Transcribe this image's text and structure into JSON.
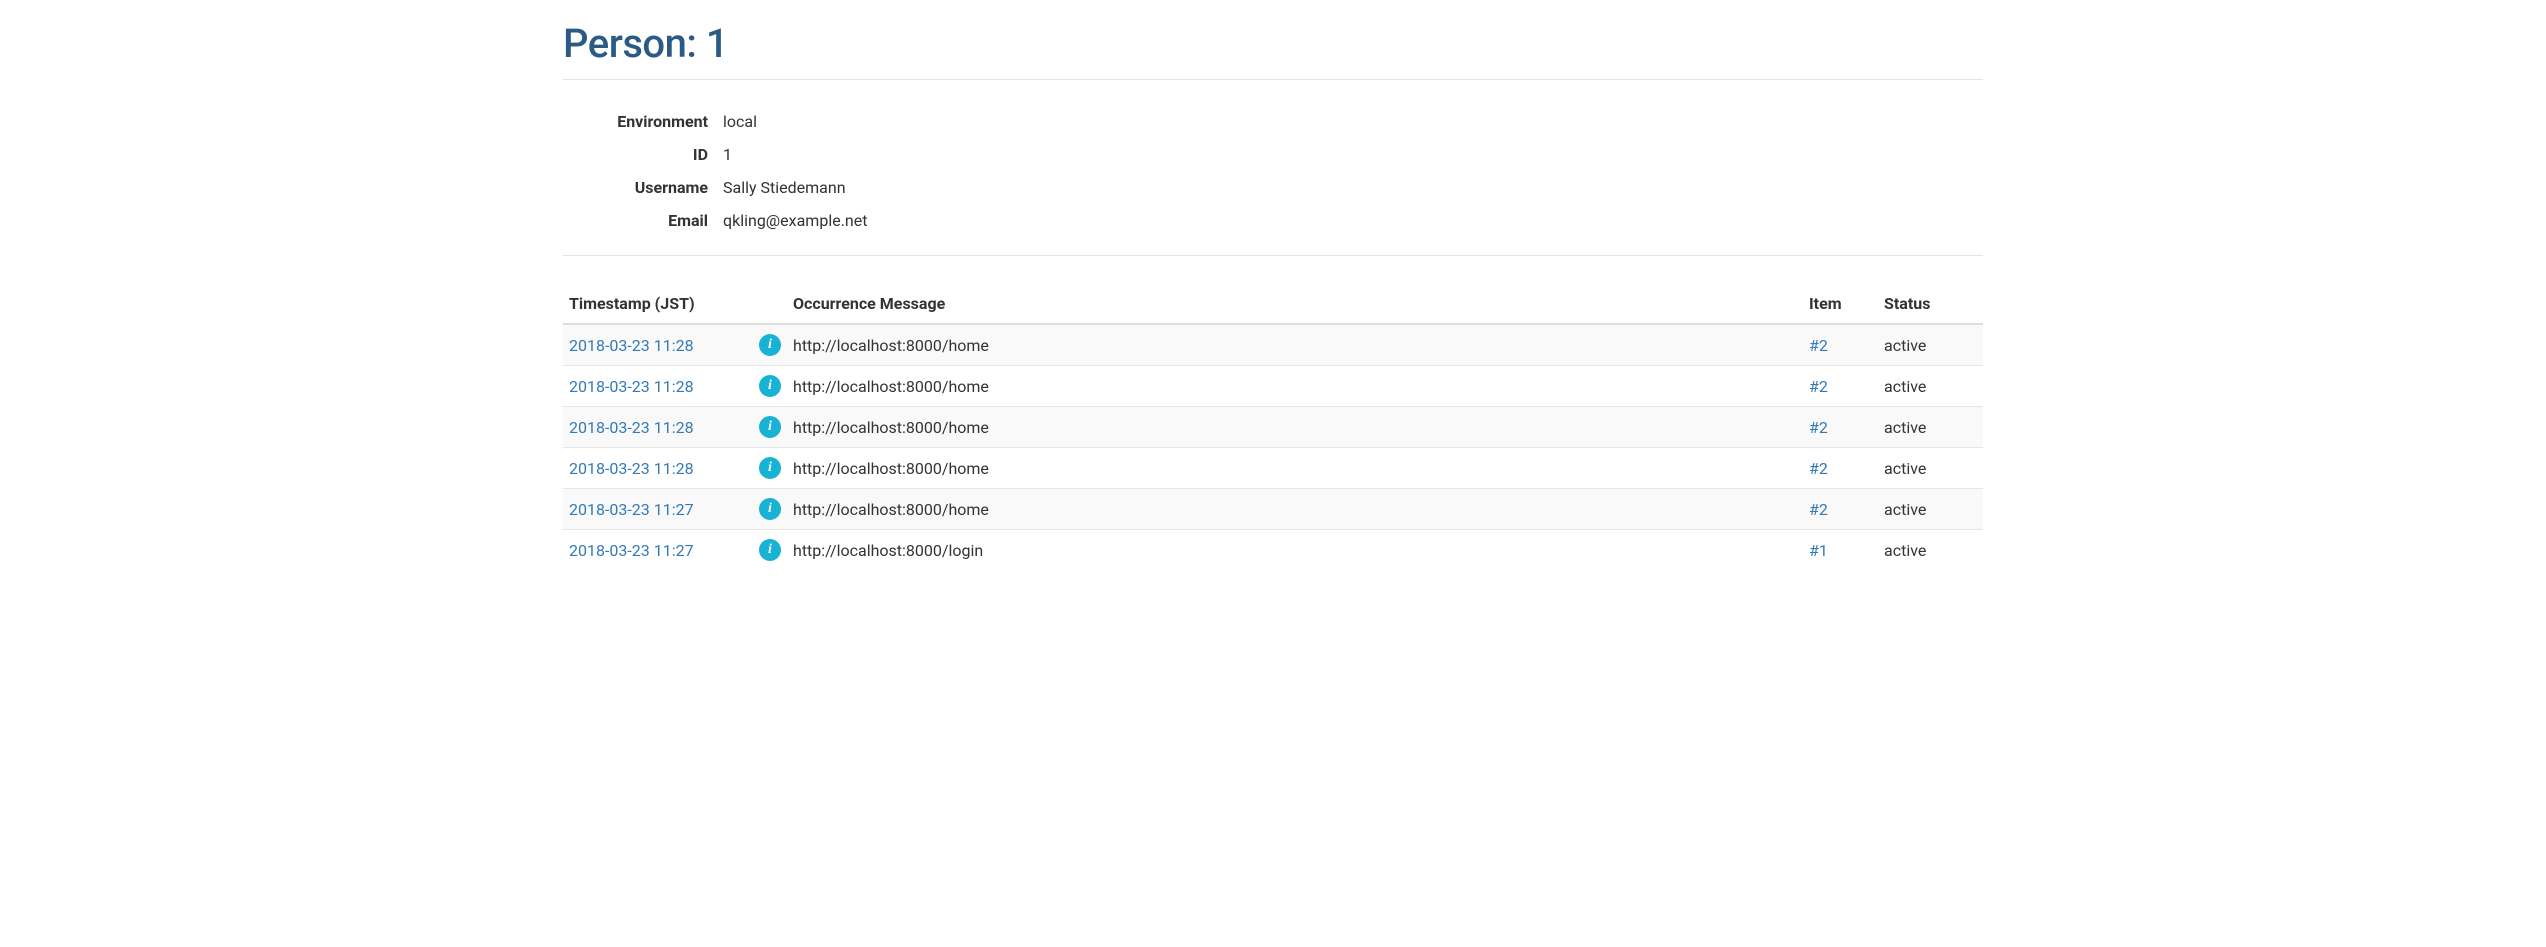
{
  "title": "Person: 1",
  "details": {
    "labels": {
      "environment": "Environment",
      "id": "ID",
      "username": "Username",
      "email": "Email"
    },
    "values": {
      "environment": "local",
      "id": "1",
      "username": "Sally Stiedemann",
      "email": "qkling@example.net"
    }
  },
  "table": {
    "headers": {
      "timestamp": "Timestamp (JST)",
      "message": "Occurrence Message",
      "item": "Item",
      "status": "Status"
    },
    "rows": [
      {
        "timestamp": "2018-03-23 11:28",
        "icon": "info",
        "message": "http://localhost:8000/home",
        "item": "#2",
        "status": "active"
      },
      {
        "timestamp": "2018-03-23 11:28",
        "icon": "info",
        "message": "http://localhost:8000/home",
        "item": "#2",
        "status": "active"
      },
      {
        "timestamp": "2018-03-23 11:28",
        "icon": "info",
        "message": "http://localhost:8000/home",
        "item": "#2",
        "status": "active"
      },
      {
        "timestamp": "2018-03-23 11:28",
        "icon": "info",
        "message": "http://localhost:8000/home",
        "item": "#2",
        "status": "active"
      },
      {
        "timestamp": "2018-03-23 11:27",
        "icon": "info",
        "message": "http://localhost:8000/home",
        "item": "#2",
        "status": "active"
      },
      {
        "timestamp": "2018-03-23 11:27",
        "icon": "info",
        "message": "http://localhost:8000/login",
        "item": "#1",
        "status": "active"
      }
    ]
  }
}
